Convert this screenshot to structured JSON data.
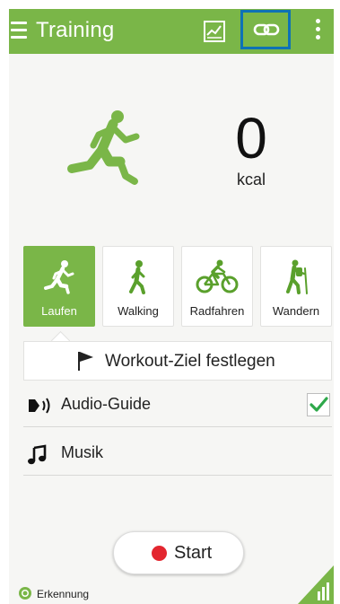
{
  "header": {
    "title": "Training",
    "menu_icon": "hamburger-menu-icon",
    "chart_icon": "chart-icon",
    "link_icon": "link-icon",
    "more_icon": "more-vertical-icon"
  },
  "calories": {
    "value": "0",
    "unit": "kcal"
  },
  "activities": [
    {
      "label": "Laufen",
      "selected": true
    },
    {
      "label": "Walking",
      "selected": false
    },
    {
      "label": "Radfahren",
      "selected": false
    },
    {
      "label": "Wandern",
      "selected": false
    }
  ],
  "goal": {
    "label": "Workout-Ziel festlegen"
  },
  "audio_guide": {
    "label": "Audio-Guide",
    "checked": true
  },
  "music": {
    "label": "Musik"
  },
  "start_button": {
    "label": "Start"
  },
  "footer": {
    "detection_label": "Erkennung"
  },
  "colors": {
    "accent": "#7ab648",
    "record": "#e3262f",
    "focus": "#0e72b5"
  }
}
